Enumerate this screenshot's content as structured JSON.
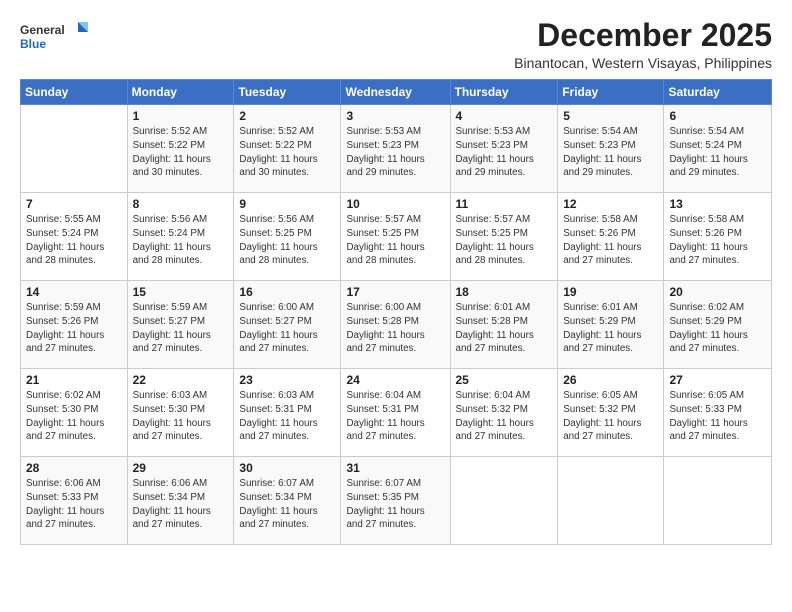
{
  "logo": {
    "general": "General",
    "blue": "Blue"
  },
  "header": {
    "month": "December 2025",
    "location": "Binantocan, Western Visayas, Philippines"
  },
  "weekdays": [
    "Sunday",
    "Monday",
    "Tuesday",
    "Wednesday",
    "Thursday",
    "Friday",
    "Saturday"
  ],
  "weeks": [
    [
      {
        "day": "",
        "info": ""
      },
      {
        "day": "1",
        "info": "Sunrise: 5:52 AM\nSunset: 5:22 PM\nDaylight: 11 hours\nand 30 minutes."
      },
      {
        "day": "2",
        "info": "Sunrise: 5:52 AM\nSunset: 5:22 PM\nDaylight: 11 hours\nand 30 minutes."
      },
      {
        "day": "3",
        "info": "Sunrise: 5:53 AM\nSunset: 5:23 PM\nDaylight: 11 hours\nand 29 minutes."
      },
      {
        "day": "4",
        "info": "Sunrise: 5:53 AM\nSunset: 5:23 PM\nDaylight: 11 hours\nand 29 minutes."
      },
      {
        "day": "5",
        "info": "Sunrise: 5:54 AM\nSunset: 5:23 PM\nDaylight: 11 hours\nand 29 minutes."
      },
      {
        "day": "6",
        "info": "Sunrise: 5:54 AM\nSunset: 5:24 PM\nDaylight: 11 hours\nand 29 minutes."
      }
    ],
    [
      {
        "day": "7",
        "info": "Sunrise: 5:55 AM\nSunset: 5:24 PM\nDaylight: 11 hours\nand 28 minutes."
      },
      {
        "day": "8",
        "info": "Sunrise: 5:56 AM\nSunset: 5:24 PM\nDaylight: 11 hours\nand 28 minutes."
      },
      {
        "day": "9",
        "info": "Sunrise: 5:56 AM\nSunset: 5:25 PM\nDaylight: 11 hours\nand 28 minutes."
      },
      {
        "day": "10",
        "info": "Sunrise: 5:57 AM\nSunset: 5:25 PM\nDaylight: 11 hours\nand 28 minutes."
      },
      {
        "day": "11",
        "info": "Sunrise: 5:57 AM\nSunset: 5:25 PM\nDaylight: 11 hours\nand 28 minutes."
      },
      {
        "day": "12",
        "info": "Sunrise: 5:58 AM\nSunset: 5:26 PM\nDaylight: 11 hours\nand 27 minutes."
      },
      {
        "day": "13",
        "info": "Sunrise: 5:58 AM\nSunset: 5:26 PM\nDaylight: 11 hours\nand 27 minutes."
      }
    ],
    [
      {
        "day": "14",
        "info": "Sunrise: 5:59 AM\nSunset: 5:26 PM\nDaylight: 11 hours\nand 27 minutes."
      },
      {
        "day": "15",
        "info": "Sunrise: 5:59 AM\nSunset: 5:27 PM\nDaylight: 11 hours\nand 27 minutes."
      },
      {
        "day": "16",
        "info": "Sunrise: 6:00 AM\nSunset: 5:27 PM\nDaylight: 11 hours\nand 27 minutes."
      },
      {
        "day": "17",
        "info": "Sunrise: 6:00 AM\nSunset: 5:28 PM\nDaylight: 11 hours\nand 27 minutes."
      },
      {
        "day": "18",
        "info": "Sunrise: 6:01 AM\nSunset: 5:28 PM\nDaylight: 11 hours\nand 27 minutes."
      },
      {
        "day": "19",
        "info": "Sunrise: 6:01 AM\nSunset: 5:29 PM\nDaylight: 11 hours\nand 27 minutes."
      },
      {
        "day": "20",
        "info": "Sunrise: 6:02 AM\nSunset: 5:29 PM\nDaylight: 11 hours\nand 27 minutes."
      }
    ],
    [
      {
        "day": "21",
        "info": "Sunrise: 6:02 AM\nSunset: 5:30 PM\nDaylight: 11 hours\nand 27 minutes."
      },
      {
        "day": "22",
        "info": "Sunrise: 6:03 AM\nSunset: 5:30 PM\nDaylight: 11 hours\nand 27 minutes."
      },
      {
        "day": "23",
        "info": "Sunrise: 6:03 AM\nSunset: 5:31 PM\nDaylight: 11 hours\nand 27 minutes."
      },
      {
        "day": "24",
        "info": "Sunrise: 6:04 AM\nSunset: 5:31 PM\nDaylight: 11 hours\nand 27 minutes."
      },
      {
        "day": "25",
        "info": "Sunrise: 6:04 AM\nSunset: 5:32 PM\nDaylight: 11 hours\nand 27 minutes."
      },
      {
        "day": "26",
        "info": "Sunrise: 6:05 AM\nSunset: 5:32 PM\nDaylight: 11 hours\nand 27 minutes."
      },
      {
        "day": "27",
        "info": "Sunrise: 6:05 AM\nSunset: 5:33 PM\nDaylight: 11 hours\nand 27 minutes."
      }
    ],
    [
      {
        "day": "28",
        "info": "Sunrise: 6:06 AM\nSunset: 5:33 PM\nDaylight: 11 hours\nand 27 minutes."
      },
      {
        "day": "29",
        "info": "Sunrise: 6:06 AM\nSunset: 5:34 PM\nDaylight: 11 hours\nand 27 minutes."
      },
      {
        "day": "30",
        "info": "Sunrise: 6:07 AM\nSunset: 5:34 PM\nDaylight: 11 hours\nand 27 minutes."
      },
      {
        "day": "31",
        "info": "Sunrise: 6:07 AM\nSunset: 5:35 PM\nDaylight: 11 hours\nand 27 minutes."
      },
      {
        "day": "",
        "info": ""
      },
      {
        "day": "",
        "info": ""
      },
      {
        "day": "",
        "info": ""
      }
    ]
  ]
}
